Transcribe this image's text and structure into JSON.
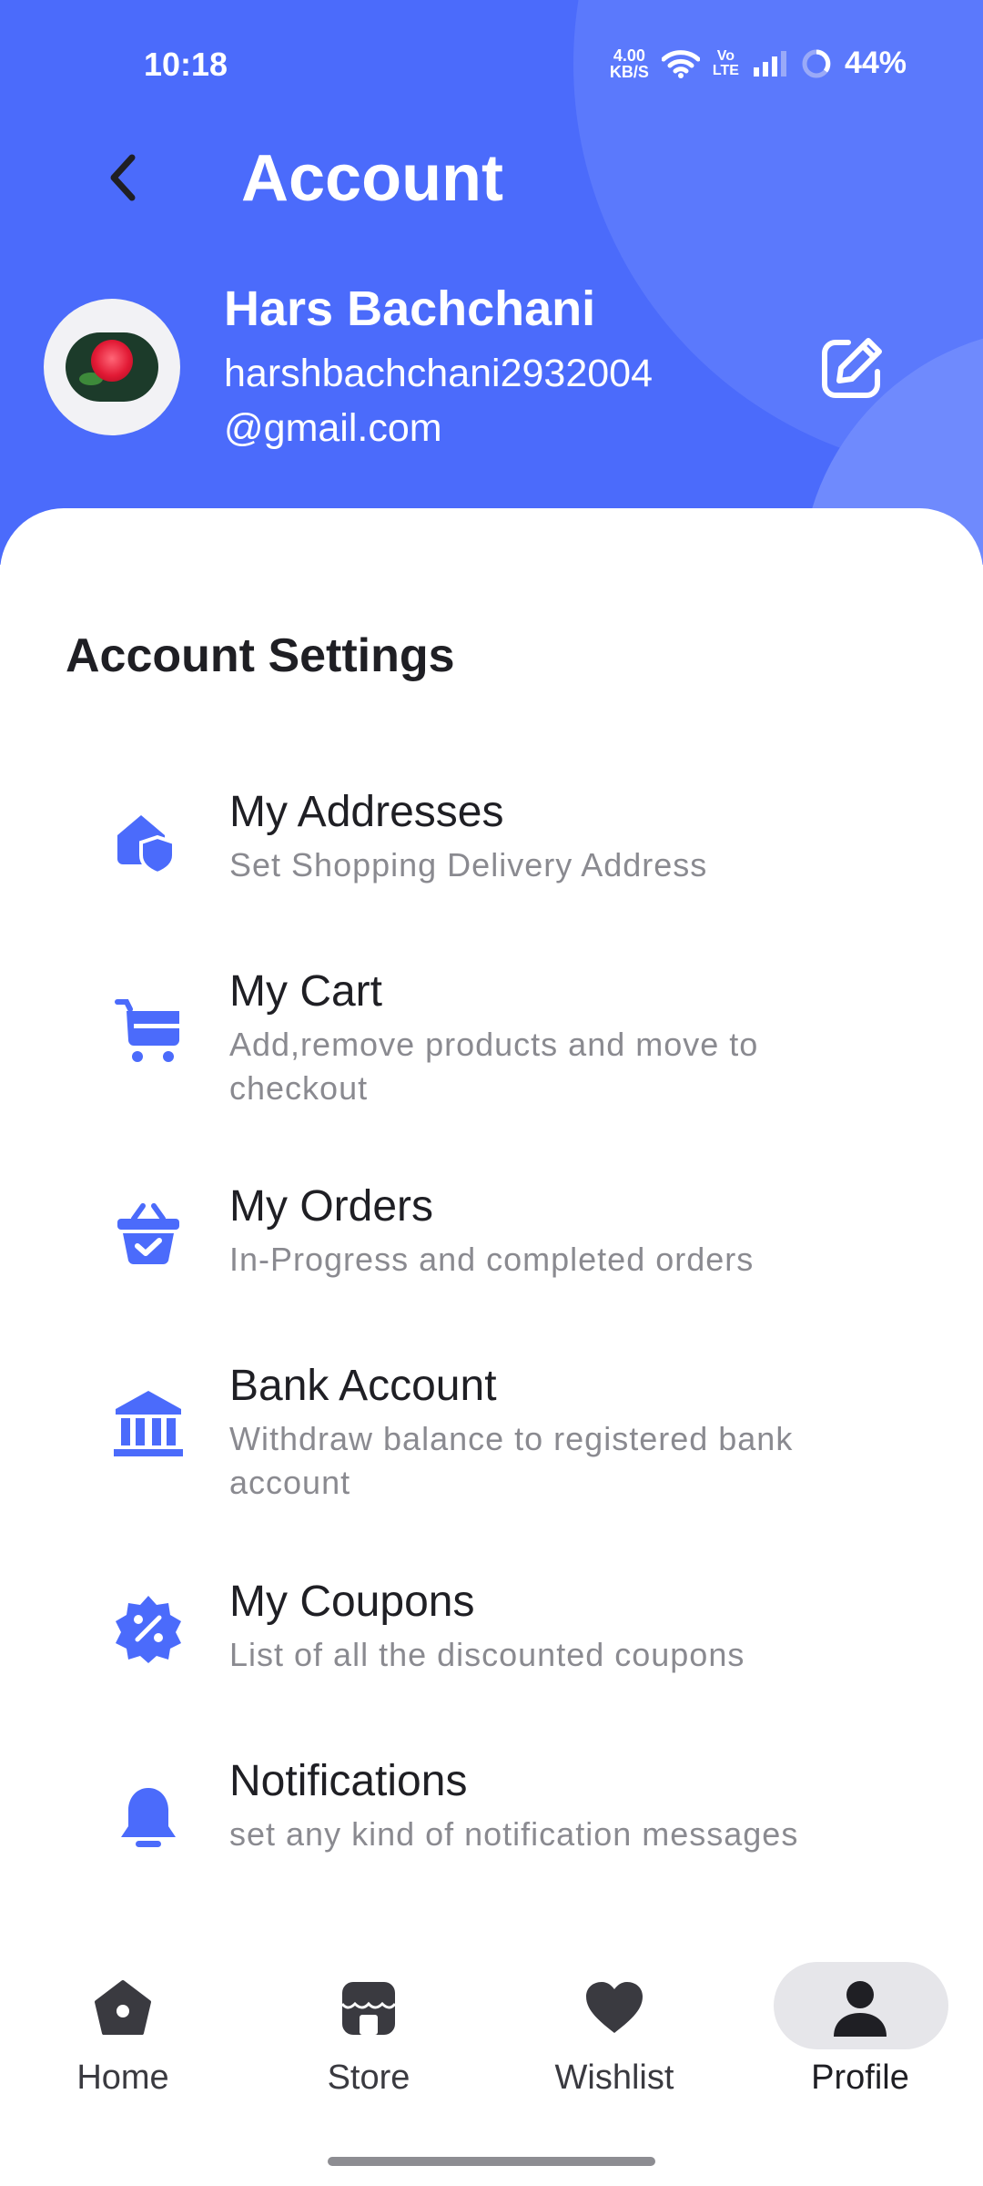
{
  "status_bar": {
    "time": "10:18",
    "speed_value": "4.00",
    "speed_unit": "KB/S",
    "volte_top": "Vo",
    "volte_bottom": "LTE",
    "battery": "44%"
  },
  "header": {
    "title": "Account",
    "user_name": "Hars Bachchani",
    "email_line1": "harshbachchani2932004",
    "email_line2": "@gmail.com"
  },
  "section_title": "Account Settings",
  "settings": [
    {
      "icon": "home-shield-icon",
      "title": "My Addresses",
      "subtitle": "Set Shopping Delivery Address"
    },
    {
      "icon": "cart-icon",
      "title": "My Cart",
      "subtitle": "Add,remove products and move to checkout"
    },
    {
      "icon": "basket-check-icon",
      "title": "My Orders",
      "subtitle": "In-Progress and completed orders"
    },
    {
      "icon": "bank-icon",
      "title": "Bank Account",
      "subtitle": "Withdraw balance to registered bank account"
    },
    {
      "icon": "discount-badge-icon",
      "title": "My Coupons",
      "subtitle": "List of all the discounted coupons"
    },
    {
      "icon": "bell-icon",
      "title": "Notifications",
      "subtitle": "set any kind of notification messages"
    }
  ],
  "bottom_nav": {
    "items": [
      {
        "label": "Home",
        "icon": "home-icon"
      },
      {
        "label": "Store",
        "icon": "store-icon"
      },
      {
        "label": "Wishlist",
        "icon": "heart-icon"
      },
      {
        "label": "Profile",
        "icon": "profile-icon",
        "selected": true
      }
    ]
  },
  "colors": {
    "primary": "#4b6bfb",
    "text": "#1f1f24",
    "subtext": "#8a8a90",
    "nav_pill": "#e6e6ea"
  }
}
